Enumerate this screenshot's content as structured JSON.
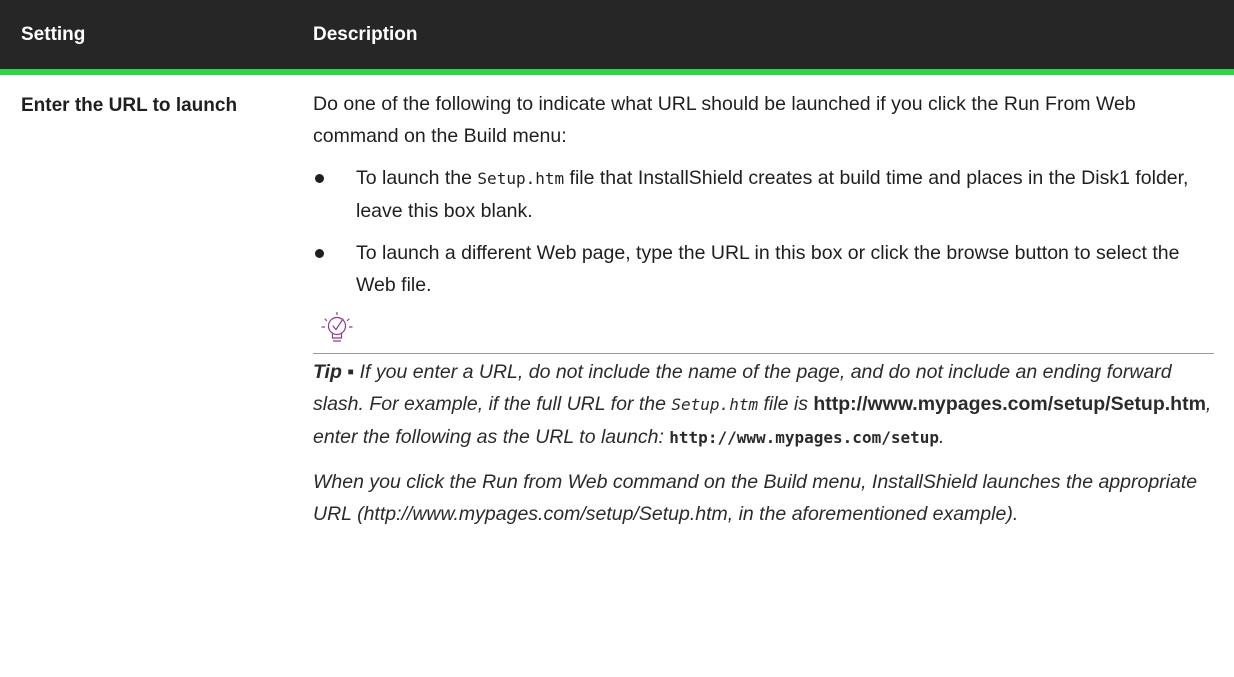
{
  "header": {
    "setting_col": "Setting",
    "description_col": "Description"
  },
  "row": {
    "setting": "Enter the URL to launch",
    "intro": "Do one of the following to indicate what URL should be launched if you click the Run From Web command on the Build menu:",
    "bullet1": {
      "pre": "To launch the ",
      "code": "Setup.htm",
      "post": " file that InstallShield creates at build time and places in the Disk1 folder, leave this box blank."
    },
    "bullet2": "To launch a different Web page, type the URL in this box or click the browse button to select the Web file.",
    "tip": {
      "label": "Tip",
      "separator": " ▪ ",
      "text1": "If you enter a URL, do not include the name of the page, and do not include an ending forward slash. For example, if the full URL for the ",
      "code1": "Setup.htm",
      "text2": " file is ",
      "bold_url": "http://www.mypages.com/setup/Setup.htm",
      "text3": ", enter the following as the URL to launch: ",
      "code2": "http://www.mypages.com/setup",
      "text4": ".",
      "para2": "When you click the Run from Web command on the Build menu, InstallShield launches the appropriate URL (http://www.mypages.com/setup/Setup.htm, in the aforementioned example)."
    }
  },
  "colors": {
    "header_bg": "#262626",
    "accent_green": "#2cd54a",
    "tip_icon": "#8e3a8f"
  },
  "icons": {
    "tip": "lightbulb-check-icon"
  }
}
